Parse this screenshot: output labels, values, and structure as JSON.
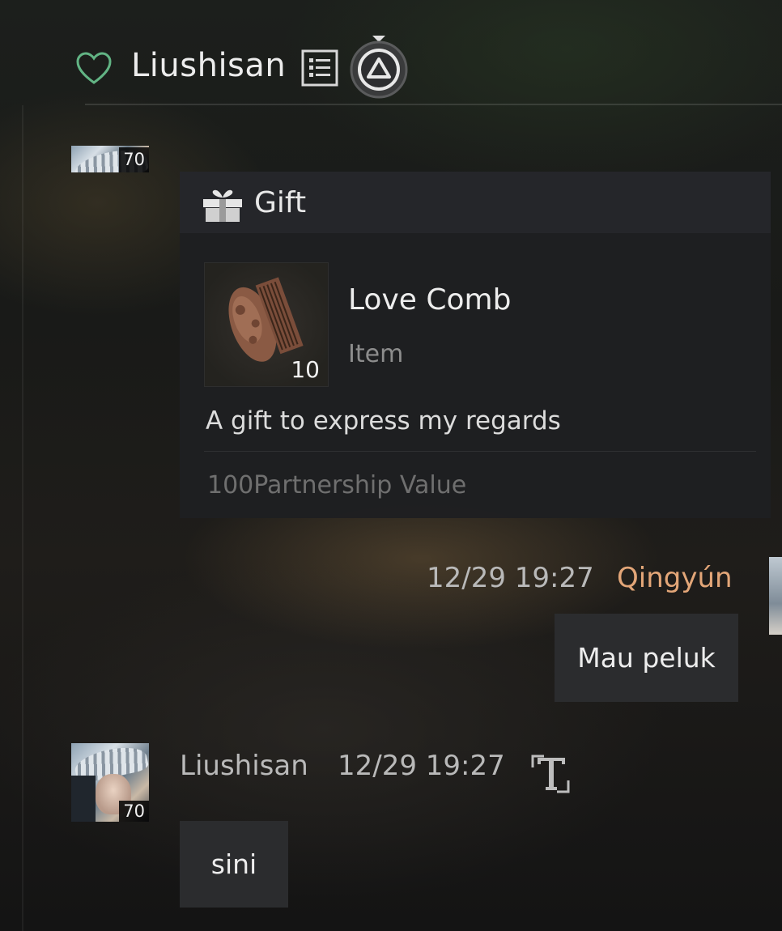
{
  "header": {
    "contact_name": "Liushisan",
    "icons": {
      "favorite": "heart-outline-icon",
      "menu": "list-icon",
      "button": "triangle-button-icon"
    },
    "heart_color": "#6fcf97"
  },
  "gift_message": {
    "sender_level": "70",
    "title": "Gift",
    "icon": "gift-box-icon",
    "item": {
      "name": "Love Comb",
      "type": "Item",
      "quantity": "10",
      "icon": "comb-icon"
    },
    "description": "A gift to express my regards",
    "partnership_value": "100Partnership Value"
  },
  "messages": [
    {
      "sender": "Qingyún",
      "time": "12/29 19:27",
      "text": "Mau peluk",
      "sender_color": "#e3a678"
    },
    {
      "sender": "Liushisan",
      "time": "12/29 19:27",
      "text": "sini",
      "level": "70",
      "icon": "translate-icon"
    }
  ]
}
